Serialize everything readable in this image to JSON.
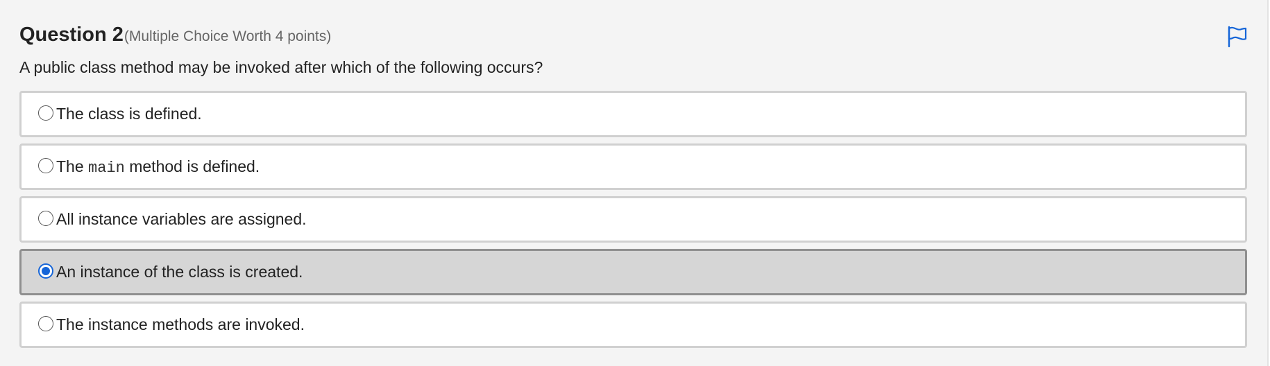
{
  "question": {
    "title": "Question 2",
    "type_info": "(Multiple Choice Worth 4 points)",
    "prompt": "A public class method may be invoked after which of the following occurs?",
    "flag_icon": "flag-icon"
  },
  "choices": [
    {
      "text": "The class is defined.",
      "selected": false
    },
    {
      "pre": "The ",
      "code": "main",
      "post": " method is defined.",
      "selected": false
    },
    {
      "text": "All instance variables are assigned.",
      "selected": false
    },
    {
      "text": "An instance of the class is created.",
      "selected": true
    },
    {
      "text": "The instance methods are invoked.",
      "selected": false
    }
  ],
  "colors": {
    "accent": "#1565d8",
    "selected_background": "#d6d6d6",
    "panel_background": "#f4f4f4"
  }
}
